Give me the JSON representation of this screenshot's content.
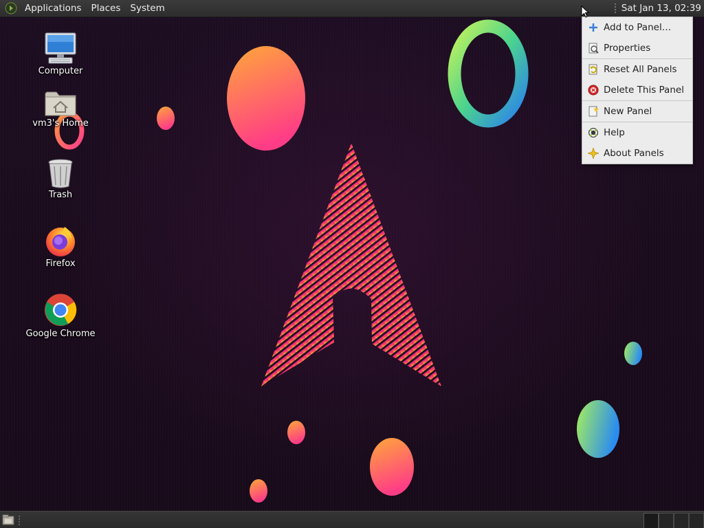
{
  "top_panel": {
    "menus": [
      "Applications",
      "Places",
      "System"
    ],
    "clock": "Sat Jan 13, 02:39"
  },
  "desktop_icons": [
    {
      "label": "Computer",
      "icon": "computer-icon"
    },
    {
      "label": "vm3's Home",
      "icon": "home-folder-icon"
    },
    {
      "label": "Trash",
      "icon": "trash-icon"
    },
    {
      "label": "Firefox",
      "icon": "firefox-icon"
    },
    {
      "label": "Google Chrome",
      "icon": "chrome-icon"
    }
  ],
  "context_menu": {
    "items": [
      {
        "label": "Add to Panel…",
        "icon": "plus-icon"
      },
      {
        "label": "Properties",
        "icon": "properties-icon"
      },
      {
        "label": "Reset All Panels",
        "icon": "reset-icon"
      },
      {
        "label": "Delete This Panel",
        "icon": "delete-icon"
      },
      {
        "label": "New Panel",
        "icon": "new-panel-icon"
      },
      {
        "label": "Help",
        "icon": "help-icon"
      },
      {
        "label": "About Panels",
        "icon": "about-icon"
      }
    ]
  },
  "bottom_panel": {
    "workspace_count": 4,
    "active_workspace": 1
  },
  "colors": {
    "panel": "#2f2f2f",
    "menu_bg": "#ececec",
    "wallpaper_bg": "#1a0d1e",
    "accent_orange": "#ff9a3c",
    "accent_pink": "#ff3c8c"
  }
}
